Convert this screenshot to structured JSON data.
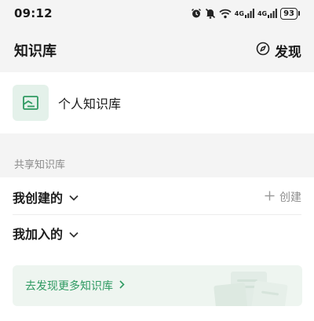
{
  "status_bar": {
    "time": "09:12",
    "signal1": "4G",
    "signal2": "4G",
    "battery": "93",
    "icons": [
      "alarm-icon",
      "mute-icon",
      "wifi-icon",
      "cellular-signal-icon",
      "cellular-signal-icon",
      "battery-icon"
    ]
  },
  "header": {
    "title": "知识库",
    "discover_label": "发现"
  },
  "personal": {
    "label": "个人知识库"
  },
  "shared": {
    "section_title": "共享知识库",
    "created_label": "我创建的",
    "create_button_label": "创建",
    "joined_label": "我加入的",
    "banner_text": "去发现更多知识库"
  },
  "colors": {
    "accent": "#2f9a62",
    "icon_bg": "#e4f1ea",
    "banner_bg": "#eef5f0",
    "page_bg": "#f4f4f4"
  }
}
